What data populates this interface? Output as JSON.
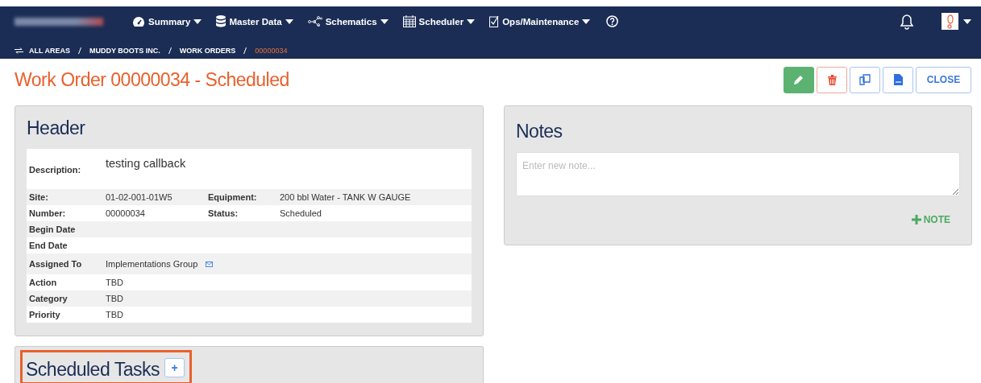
{
  "nav": {
    "menus": [
      {
        "label": "Summary"
      },
      {
        "label": "Master Data"
      },
      {
        "label": "Schematics"
      },
      {
        "label": "Scheduler"
      },
      {
        "label": "Ops/Maintenance"
      }
    ]
  },
  "breadcrumb": [
    {
      "label": "ALL AREAS",
      "selected": false
    },
    {
      "label": "MUDDY BOOTS INC.",
      "selected": false
    },
    {
      "label": "WORK ORDERS",
      "selected": false
    },
    {
      "label": "00000034",
      "selected": true
    }
  ],
  "page_title": "Work Order 00000034 - Scheduled",
  "actions": [
    {
      "kind": "edit"
    },
    {
      "kind": "delete"
    },
    {
      "kind": "copy"
    },
    {
      "kind": "pdf"
    },
    {
      "kind": "text",
      "label": "CLOSE"
    }
  ],
  "header": {
    "title": "Header",
    "rows": [
      {
        "kind": "description",
        "fields": [
          {
            "label": "Description:",
            "value": "testing callback"
          }
        ]
      },
      {
        "kind": "field",
        "fields": [
          {
            "label": "Site:",
            "value": "01-02-001-01W5"
          },
          {
            "label": "Equipment:",
            "value": "200 bbl Water - TANK W GAUGE"
          }
        ]
      },
      {
        "kind": "field",
        "fields": [
          {
            "label": "Number:",
            "value": "00000034"
          },
          {
            "label": "Status:",
            "value": "Scheduled"
          }
        ]
      },
      {
        "kind": "field",
        "fields": [
          {
            "label": "Begin Date"
          }
        ]
      },
      {
        "kind": "field",
        "fields": [
          {
            "label": "End Date"
          }
        ]
      },
      {
        "kind": "contact",
        "fields": [
          {
            "label": "Assigned To",
            "value": "Implementations Group"
          }
        ]
      },
      {
        "kind": "field",
        "fields": [
          {
            "label": "Action",
            "value": "TBD"
          }
        ]
      },
      {
        "kind": "field",
        "fields": [
          {
            "label": "Category",
            "value": "TBD"
          }
        ]
      },
      {
        "kind": "field",
        "fields": [
          {
            "label": "Priority",
            "value": "TBD"
          }
        ]
      }
    ]
  },
  "notes": {
    "title": "Notes",
    "placeholder": "Enter new note...",
    "add_label": "NOTE"
  },
  "tasks": {
    "title": "Scheduled Tasks",
    "add_label": "+"
  }
}
